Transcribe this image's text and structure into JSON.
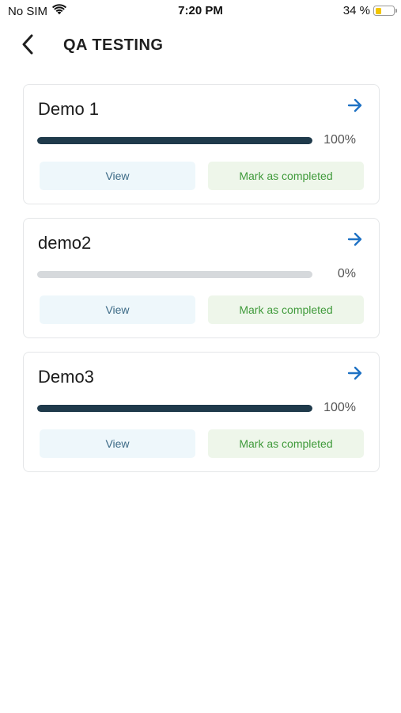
{
  "status_bar": {
    "carrier": "No SIM",
    "time": "7:20 PM",
    "battery": "34 %",
    "battery_level": 0.34
  },
  "header": {
    "title": "QA TESTING",
    "back_icon": "chevron-left-icon"
  },
  "cards": [
    {
      "title": "Demo 1",
      "progress": 100,
      "progress_label": "100%",
      "view_label": "View",
      "complete_label": "Mark as completed",
      "arrow_icon": "arrow-right-icon"
    },
    {
      "title": "demo2",
      "progress": 0,
      "progress_label": "0%",
      "view_label": "View",
      "complete_label": "Mark as completed",
      "arrow_icon": "arrow-right-icon"
    },
    {
      "title": "Demo3",
      "progress": 100,
      "progress_label": "100%",
      "view_label": "View",
      "complete_label": "Mark as completed",
      "arrow_icon": "arrow-right-icon"
    }
  ],
  "colors": {
    "accent_arrow": "#1f72c4",
    "progress_fill": "#1f3a4b",
    "view_text": "#3c6a86",
    "complete_text": "#3f9a3a",
    "battery": "#f2c500"
  }
}
